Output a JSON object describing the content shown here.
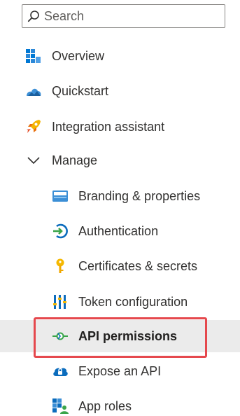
{
  "search": {
    "placeholder": "Search"
  },
  "nav": {
    "overview": "Overview",
    "quickstart": "Quickstart",
    "integration": "Integration assistant",
    "manage": "Manage",
    "manage_items": [
      {
        "label": "Branding & properties",
        "icon": "branding-icon"
      },
      {
        "label": "Authentication",
        "icon": "authentication-icon"
      },
      {
        "label": "Certificates & secrets",
        "icon": "key-icon"
      },
      {
        "label": "Token configuration",
        "icon": "token-config-icon"
      },
      {
        "label": "API permissions",
        "icon": "api-permissions-icon",
        "selected": true
      },
      {
        "label": "Expose an API",
        "icon": "cloud-icon"
      },
      {
        "label": "App roles",
        "icon": "app-roles-icon"
      }
    ]
  },
  "colors": {
    "selected_background": "#ebebeb",
    "highlight_border": "#e5484d",
    "accent_blue": "#0078d4"
  }
}
